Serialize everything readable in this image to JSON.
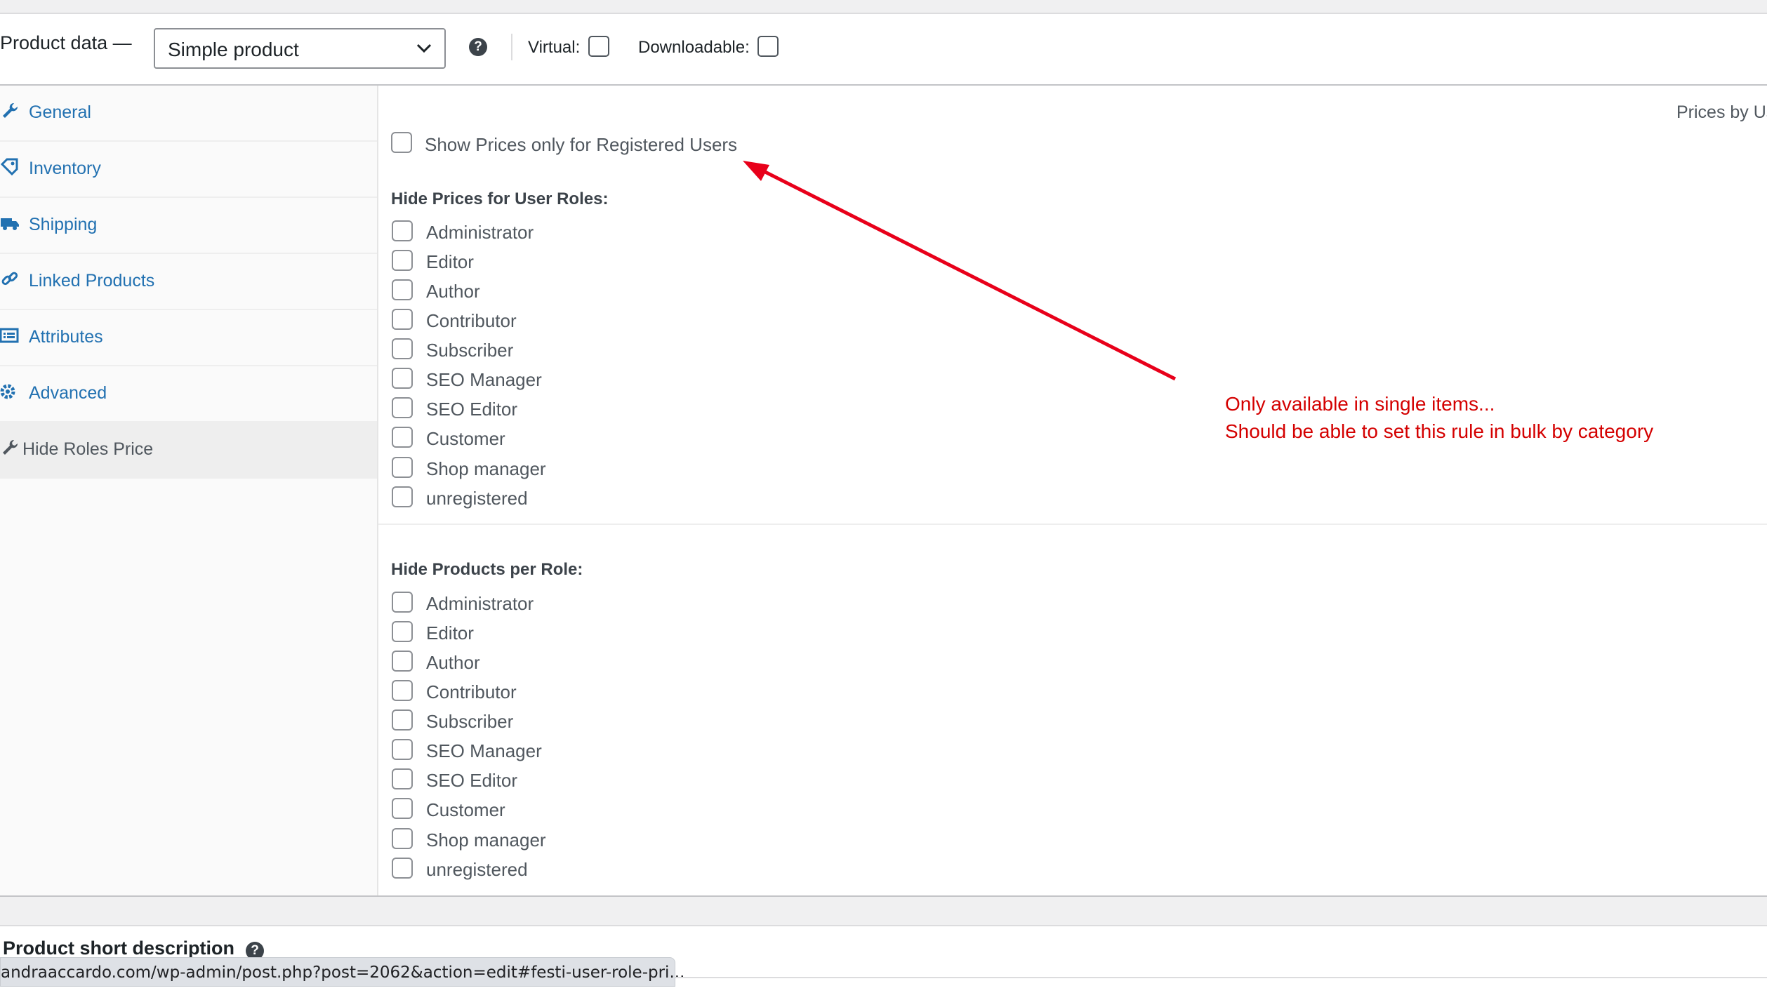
{
  "header": {
    "title": "Product data —",
    "product_type": "Simple product",
    "help_icon": "question-circle-icon",
    "virtual_label": "Virtual:",
    "downloadable_label": "Downloadable:"
  },
  "sidebar": {
    "tabs": [
      {
        "label": "General",
        "icon": "wrench-icon"
      },
      {
        "label": "Inventory",
        "icon": "tag-icon"
      },
      {
        "label": "Shipping",
        "icon": "truck-icon"
      },
      {
        "label": "Linked Products",
        "icon": "link-icon"
      },
      {
        "label": "Attributes",
        "icon": "list-icon"
      },
      {
        "label": "Advanced",
        "icon": "gear-icon"
      },
      {
        "label": "Hide Roles Price",
        "icon": "wrench-icon",
        "active": true
      }
    ]
  },
  "panel": {
    "title_partial": "Prices by Us",
    "registered_only_label": "Show Prices only for Registered Users",
    "hide_prices_heading": "Hide Prices for User Roles:",
    "hide_products_heading": "Hide Products per Role:",
    "roles": [
      "Administrator",
      "Editor",
      "Author",
      "Contributor",
      "Subscriber",
      "SEO Manager",
      "SEO Editor",
      "Customer",
      "Shop manager",
      "unregistered"
    ]
  },
  "annotation": {
    "line1": "Only available in single items...",
    "line2": "Should be able to set this rule in bulk by category",
    "color": "#d40000"
  },
  "bottom": {
    "short_description_label": "Product short description",
    "status_url": "andraaccardo.com/wp-admin/post.php?post=2062&action=edit#festi-user-role-pri..."
  }
}
